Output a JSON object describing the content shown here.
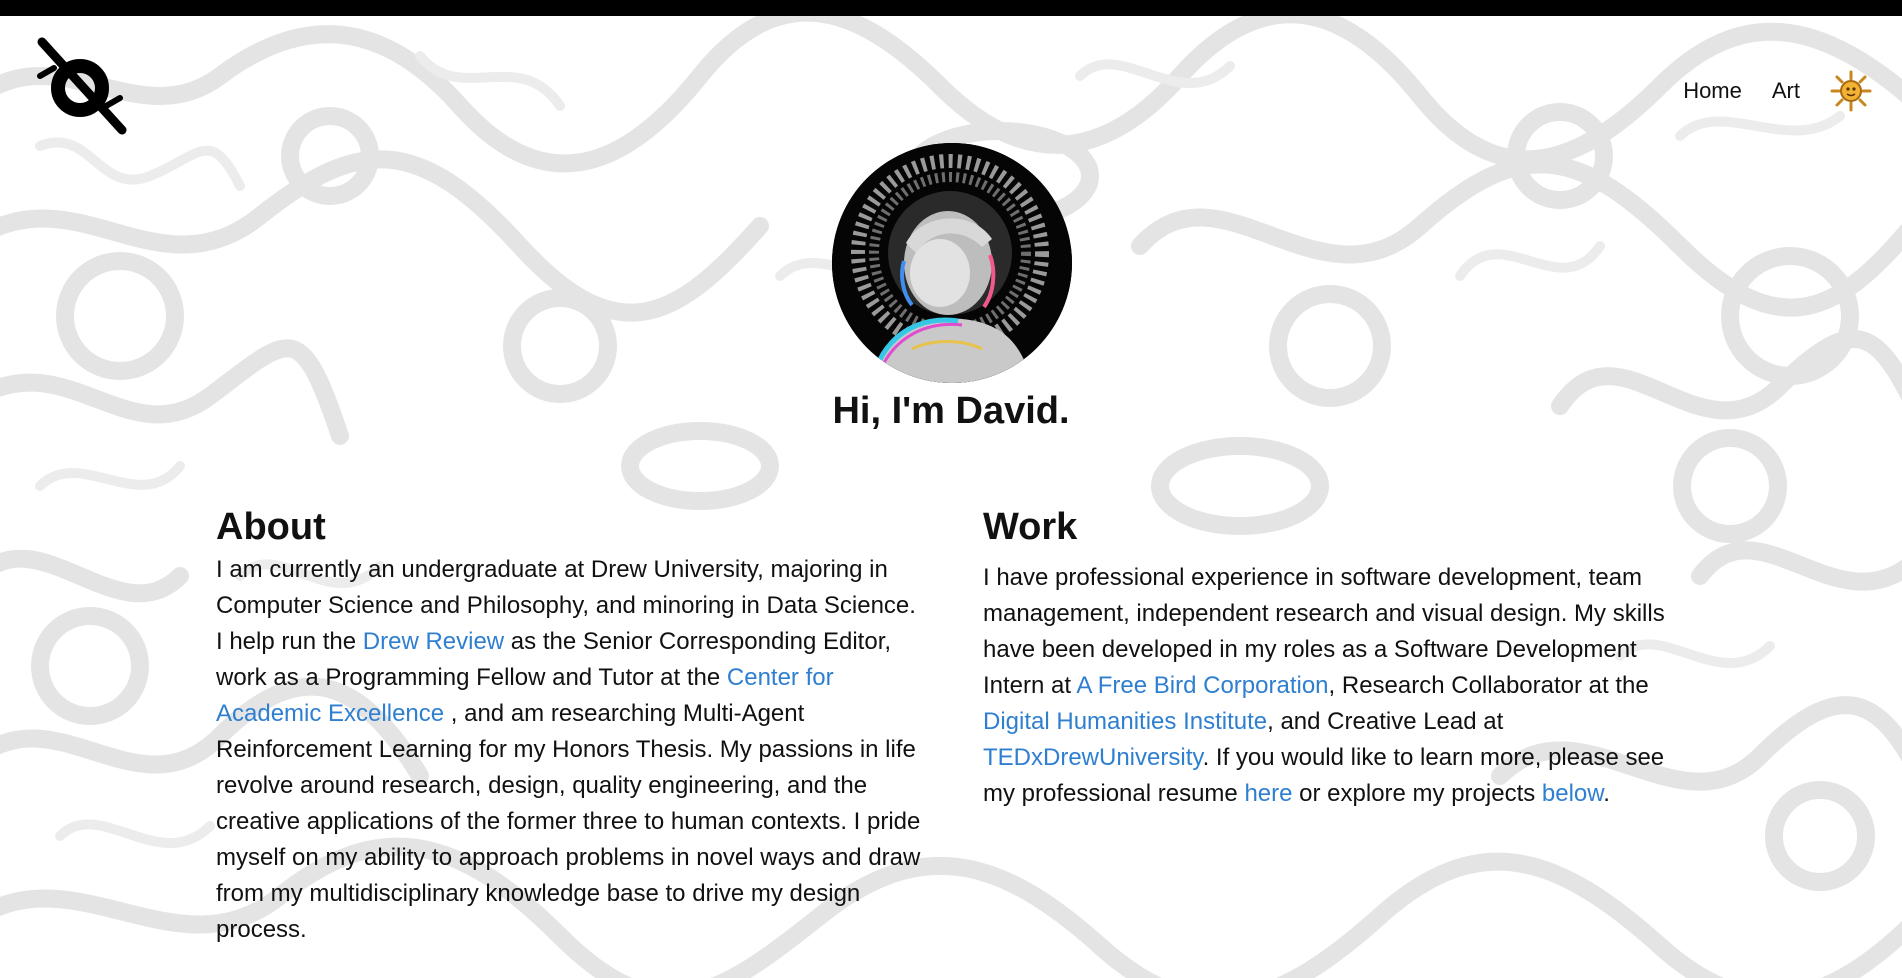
{
  "nav": {
    "home_label": "Home",
    "art_label": "Art"
  },
  "hero": {
    "greeting": "Hi, I'm David."
  },
  "about": {
    "heading": "About",
    "text_1": "I am currently an undergraduate at Drew University, majoring in Computer Science and Philosophy, and minoring in Data Science. I help run the ",
    "link_drew_review": "Drew Review",
    "text_2": " as the Senior Corresponding Editor, work as a Programming Fellow and Tutor at the ",
    "link_cae": "Center for Academic Excellence",
    "text_3": " , and am researching Multi-Agent Reinforcement Learning for my Honors Thesis. My passions in life revolve around research, design, quality engineering, and the creative applications of the former three to human contexts. I pride myself on my ability to approach problems in novel ways and draw from my multidisciplinary knowledge base to drive my design process."
  },
  "work": {
    "heading": "Work",
    "text_1": "I have professional experience in software development, team management, independent research and visual design. My skills have been developed in my roles as a Software Development Intern at ",
    "link_free_bird": "A Free Bird Corporation",
    "text_2": ", Research Collaborator at the ",
    "link_dhi": "Digital Humanities Institute",
    "text_3": ", and Creative Lead at ",
    "link_tedx": "TEDxDrewUniversity",
    "text_4": ". If you would like to learn more, please see my professional resume ",
    "link_here": "here",
    "text_5": " or explore my projects ",
    "link_below": "below",
    "text_6": "."
  },
  "colors": {
    "link": "#2f7fd1",
    "text": "#111111",
    "doodle": "#e4e4e4",
    "top_bar": "#000000"
  },
  "icons": {
    "logo": "slashed-circle-logo-icon",
    "theme_toggle": "sun-icon",
    "avatar": "profile-photo"
  }
}
